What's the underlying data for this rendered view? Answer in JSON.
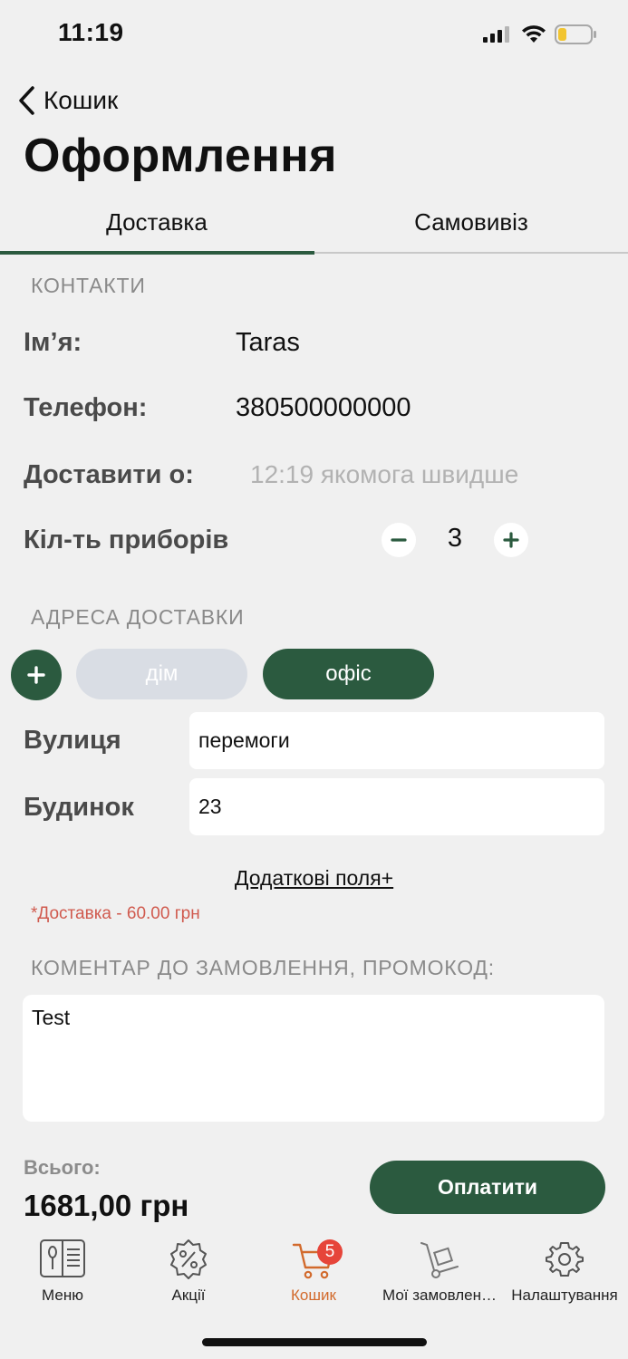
{
  "status": {
    "time": "11:19"
  },
  "nav": {
    "back_label": "Кошик",
    "title": "Оформлення"
  },
  "tabs": [
    {
      "label": "Доставка",
      "active": true
    },
    {
      "label": "Самовивіз",
      "active": false
    }
  ],
  "contacts": {
    "section_label": "КОНТАКТИ",
    "name_label": "Ім’я:",
    "name_value": "Taras",
    "phone_label": "Телефон:",
    "phone_value": "380500000000",
    "deliver_label": "Доставити о:",
    "deliver_placeholder": "12:19 якомога швидше",
    "cutlery_label": "Кіл-ть приборів",
    "cutlery_count": "3"
  },
  "address": {
    "section_label": "АДРЕСА ДОСТАВКИ",
    "chips": [
      {
        "label": "дім",
        "selected": false
      },
      {
        "label": "офіс",
        "selected": true
      }
    ],
    "street_label": "Вулиця",
    "street_value": "перемоги",
    "house_label": "Будинок",
    "house_value": "23",
    "extra_fields_link": "Додаткові поля+",
    "delivery_note": "*Доставка - 60.00 грн"
  },
  "comment": {
    "section_label": "КОМЕНТАР ДО ЗАМОВЛЕННЯ, ПРОМОКОД:",
    "value": "Test"
  },
  "summary": {
    "total_label": "Всього:",
    "total_value": "1681,00 грн",
    "pay_label": "Оплатити"
  },
  "tabbar": {
    "items": [
      {
        "label": "Меню",
        "icon": "menu-book-icon"
      },
      {
        "label": "Акції",
        "icon": "percent-badge-icon"
      },
      {
        "label": "Кошик",
        "icon": "cart-icon",
        "active": true,
        "badge": "5"
      },
      {
        "label": "Мої замовлен…",
        "icon": "hand-truck-icon"
      },
      {
        "label": "Налаштування",
        "icon": "gear-icon"
      }
    ]
  },
  "colors": {
    "accent": "#2b5a3f",
    "active_tab": "#d26a2c",
    "badge": "#e6453a",
    "note": "#d05a4e"
  }
}
